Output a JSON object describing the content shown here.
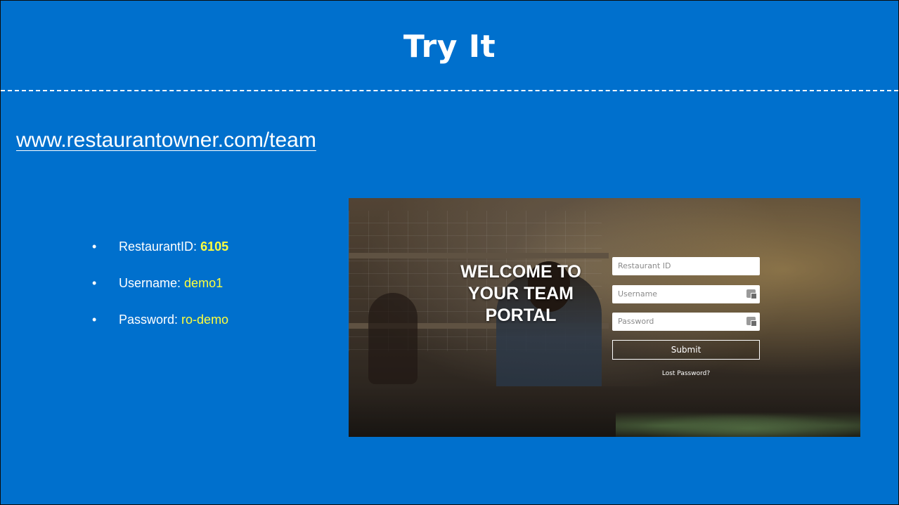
{
  "slide": {
    "title": "Try It",
    "url": "www.restaurantowner.com/team",
    "credentials": [
      {
        "label": "RestaurantID: ",
        "value": "6105",
        "bullet": "•"
      },
      {
        "label": "Username: ",
        "value": "demo1",
        "bullet": "•"
      },
      {
        "label": "Password: ",
        "value": "ro-demo",
        "bullet": "•"
      }
    ],
    "colors": {
      "background": "#0070cd",
      "highlight": "#ffff3d",
      "text": "#ffffff"
    }
  },
  "portal": {
    "welcome_lines": [
      "WELCOME TO",
      "YOUR TEAM",
      "PORTAL"
    ],
    "restaurant_id_placeholder": "Restaurant ID",
    "username_placeholder": "Username",
    "password_placeholder": "Password",
    "submit_label": "Submit",
    "lost_password_label": "Lost Password?",
    "field_icons": [
      "keyboard-icon",
      "keyboard-icon"
    ]
  }
}
